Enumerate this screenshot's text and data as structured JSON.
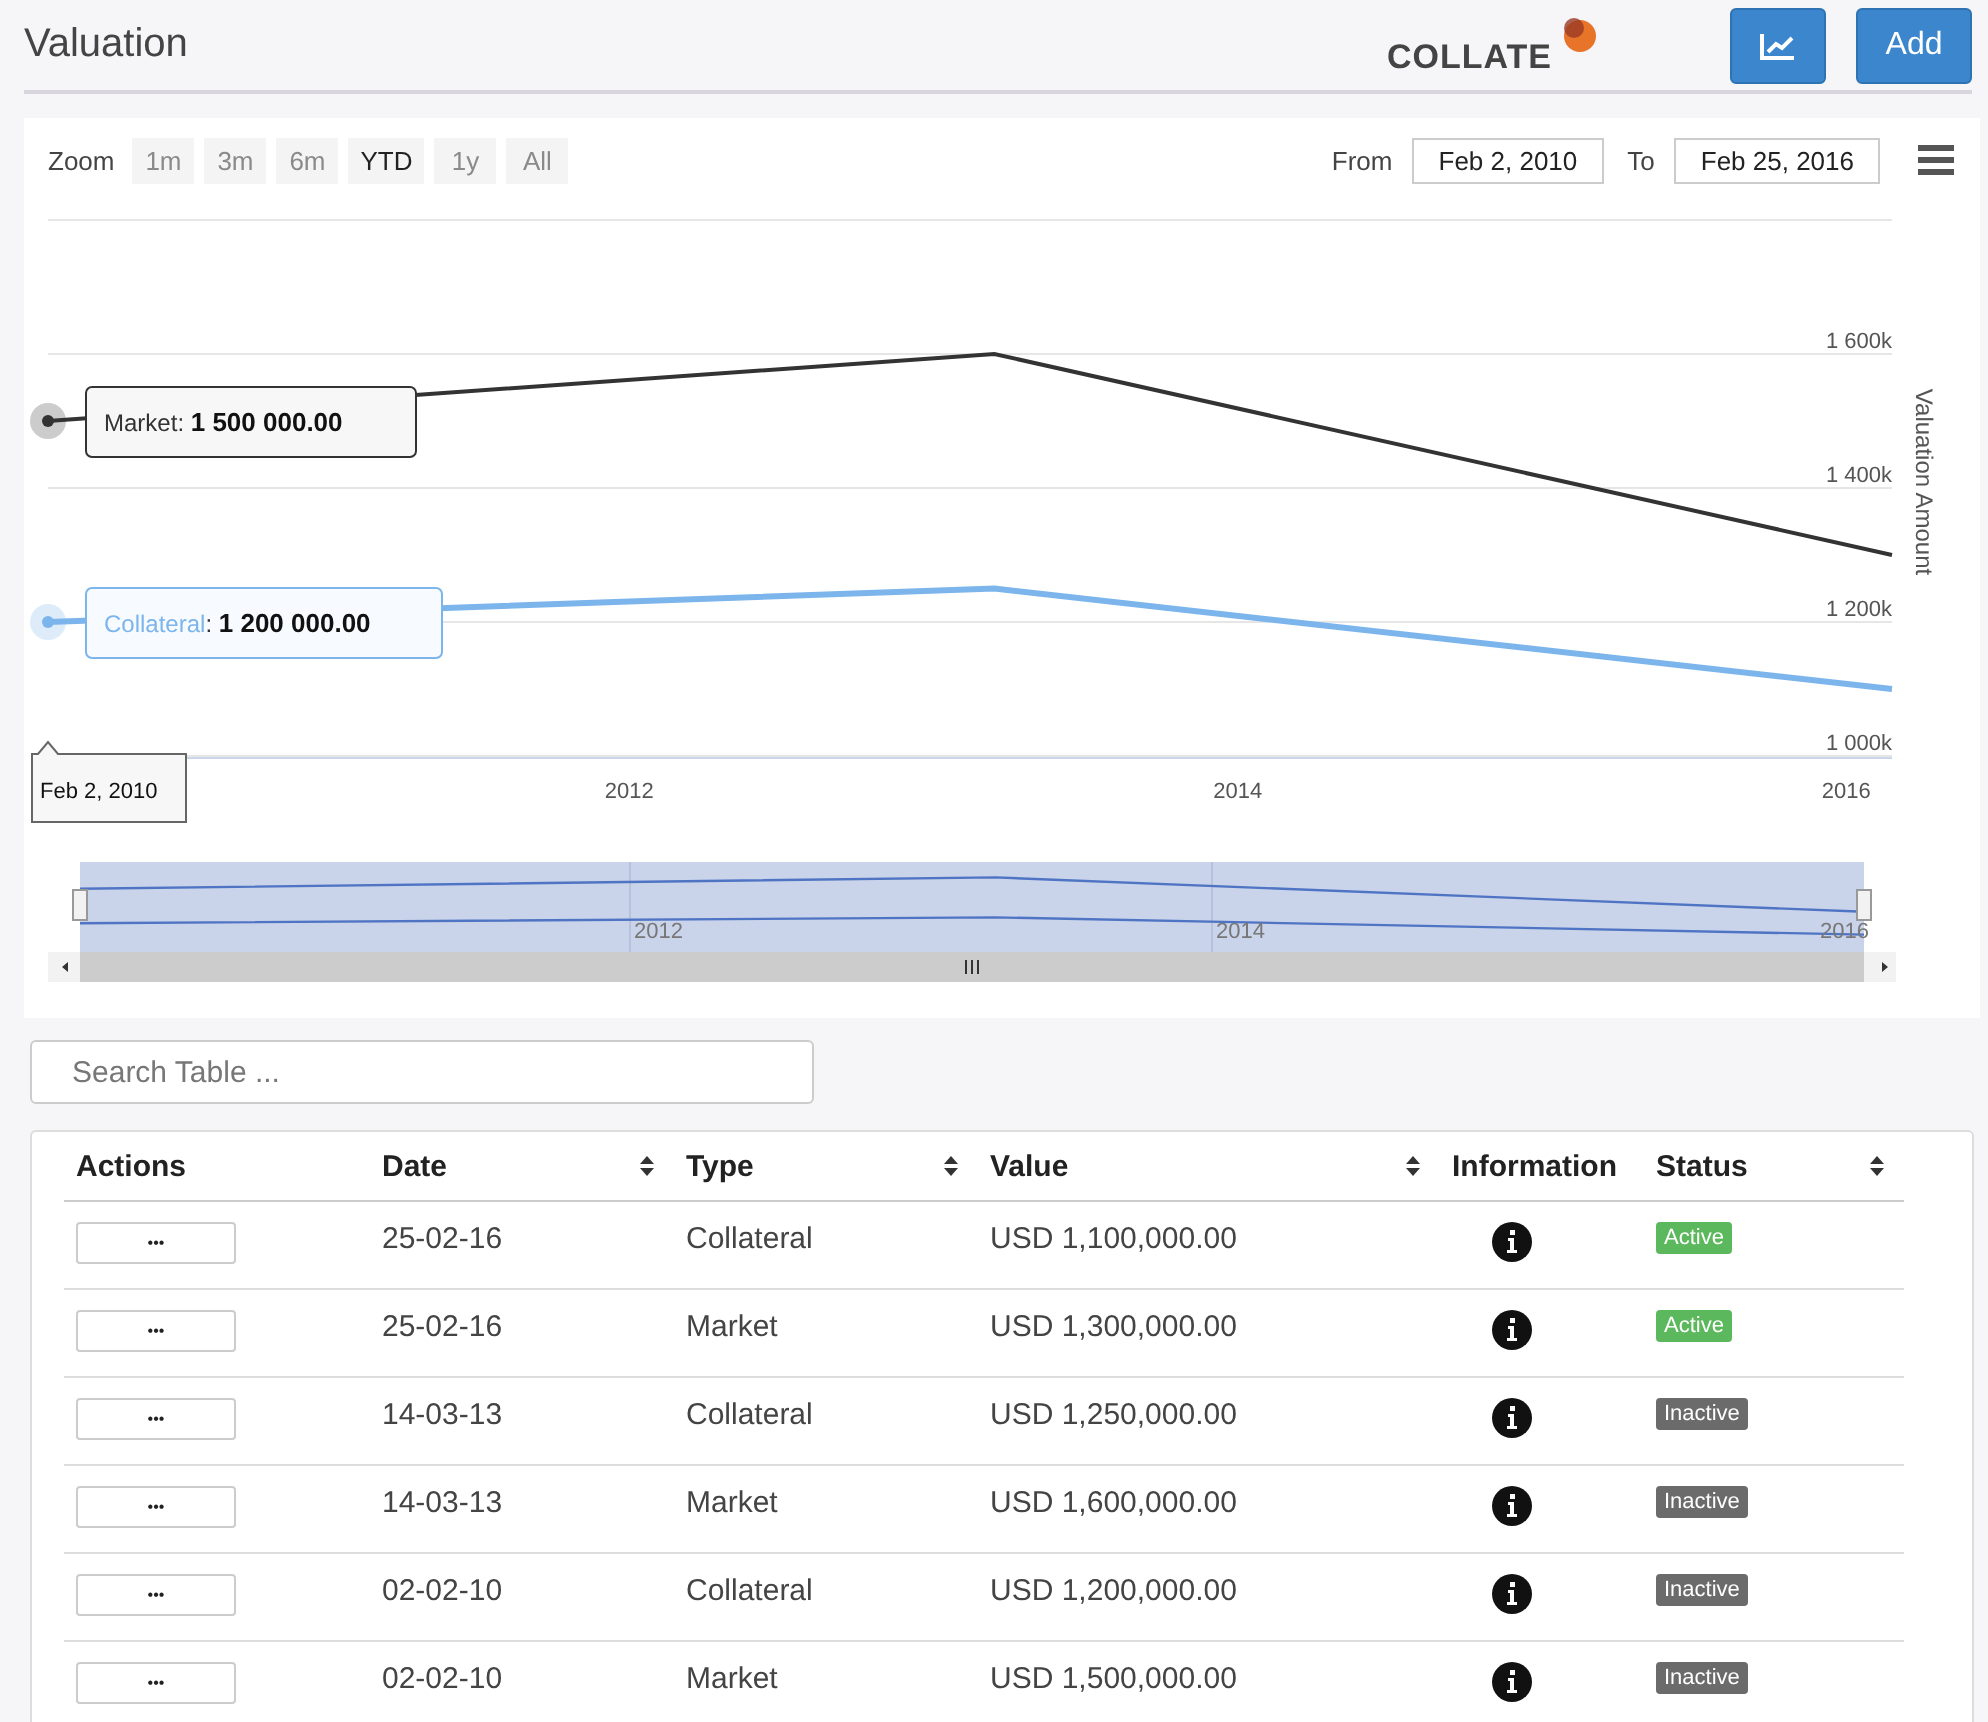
{
  "header": {
    "title": "Valuation",
    "logo": "COLLATE",
    "buttons": [
      {
        "kind": "chart"
      },
      {
        "kind": "text",
        "label": "Add"
      }
    ]
  },
  "chart_panel": {
    "zoom_label": "Zoom",
    "zoom_options": [
      {
        "label": "1m",
        "selected": false
      },
      {
        "label": "3m",
        "selected": false
      },
      {
        "label": "6m",
        "selected": false
      },
      {
        "label": "YTD",
        "selected": true
      },
      {
        "label": "1y",
        "selected": false
      },
      {
        "label": "All",
        "selected": false
      }
    ],
    "from_label": "From",
    "from_value": "Feb 2, 2010",
    "to_label": "To",
    "to_value": "Feb 25, 2016",
    "chart_data": {
      "type": "line",
      "ylabel": "Valuation Amount",
      "x": [
        2010.09,
        2013.2,
        2016.15
      ],
      "xlim": [
        2010.09,
        2016.15
      ],
      "grid": true,
      "ylim": [
        1000000,
        1800000
      ],
      "series": [
        {
          "name": "Market",
          "color": "#333333",
          "values": [
            1500000,
            1600000,
            1300000
          ]
        },
        {
          "name": "Collateral",
          "color": "#7cb5ec",
          "values": [
            1200000,
            1250000,
            1100000
          ]
        }
      ],
      "xticks": [
        {
          "value": 2012,
          "label": "2012"
        },
        {
          "value": 2014,
          "label": "2014"
        },
        {
          "value": 2016,
          "label": "2016"
        }
      ],
      "yticks": [
        {
          "value": 1000000,
          "label": "1 000k"
        },
        {
          "value": 1200000,
          "label": "1 200k"
        },
        {
          "value": 1400000,
          "label": "1 400k"
        },
        {
          "value": 1600000,
          "label": "1 600k"
        }
      ]
    },
    "tooltips": [
      {
        "separator": ":",
        "value": "1 500 000.00"
      },
      {
        "separator": ":",
        "value": "1 200 000.00"
      }
    ],
    "tooltip_date": "Feb 2, 2010",
    "navigator_labels": [
      "2012",
      "2014",
      "2016"
    ]
  },
  "search": {
    "placeholder": "Search Table ..."
  },
  "table": {
    "columns": [
      {
        "label": "Actions",
        "sortable": false
      },
      {
        "label": "Date",
        "sortable": true
      },
      {
        "label": "Type",
        "sortable": true
      },
      {
        "label": "Value",
        "sortable": true
      },
      {
        "label": "Information",
        "sortable": false
      },
      {
        "label": "Status",
        "sortable": true
      }
    ],
    "rows": [
      {
        "action": "•••",
        "date": "25-02-16",
        "type": "Collateral",
        "value": "USD 1,100,000.00",
        "status": "Active",
        "color": "#5cb85c"
      },
      {
        "action": "•••",
        "date": "25-02-16",
        "type": "Market",
        "value": "USD 1,300,000.00",
        "status": "Active",
        "color": "#5cb85c"
      },
      {
        "action": "•••",
        "date": "14-03-13",
        "type": "Collateral",
        "value": "USD 1,250,000.00",
        "status": "Inactive",
        "color": "#6b6b6b"
      },
      {
        "action": "•••",
        "date": "14-03-13",
        "type": "Market",
        "value": "USD 1,600,000.00",
        "status": "Inactive",
        "color": "#6b6b6b"
      },
      {
        "action": "•••",
        "date": "02-02-10",
        "type": "Collateral",
        "value": "USD 1,200,000.00",
        "status": "Inactive",
        "color": "#6b6b6b"
      },
      {
        "action": "•••",
        "date": "02-02-10",
        "type": "Market",
        "value": "USD 1,500,000.00",
        "status": "Inactive",
        "color": "#6b6b6b"
      }
    ]
  }
}
